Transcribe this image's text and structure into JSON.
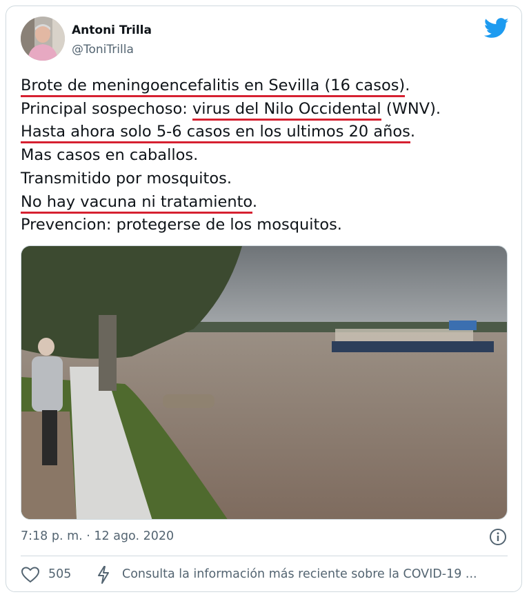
{
  "author": {
    "name": "Antoni Trilla",
    "handle": "@ToniTrilla"
  },
  "tweet_lines": [
    {
      "pre": "",
      "u": "Brote de meningoencefalitis en Sevilla (16 casos)",
      "post": "."
    },
    {
      "pre": "Principal sospechoso: ",
      "u": "virus del Nilo Occidental",
      "post": " (WNV)."
    },
    {
      "pre": "",
      "u": "Hasta ahora solo 5-6 casos en los ultimos 20 años",
      "post": "."
    },
    {
      "pre": "Mas casos en caballos.",
      "u": "",
      "post": ""
    },
    {
      "pre": "Transmitido por mosquitos.",
      "u": "",
      "post": ""
    },
    {
      "pre": "",
      "u": "No hay vacuna ni tratamiento",
      "post": "."
    },
    {
      "pre": "Prevencion: protegerse de los mosquitos.",
      "u": "",
      "post": ""
    }
  ],
  "timestamp": "7:18 p. m. · 12 ago. 2020",
  "likes": "505",
  "covid_notice": "Consulta la información más reciente sobre la COVID-19 ...",
  "colors": {
    "underline": "#d62030",
    "twitter_blue": "#1d9bf0",
    "muted": "#536471"
  },
  "icons": {
    "brand": "twitter-bird-icon",
    "info": "info-icon",
    "like": "heart-icon",
    "covid": "lightning-icon"
  }
}
